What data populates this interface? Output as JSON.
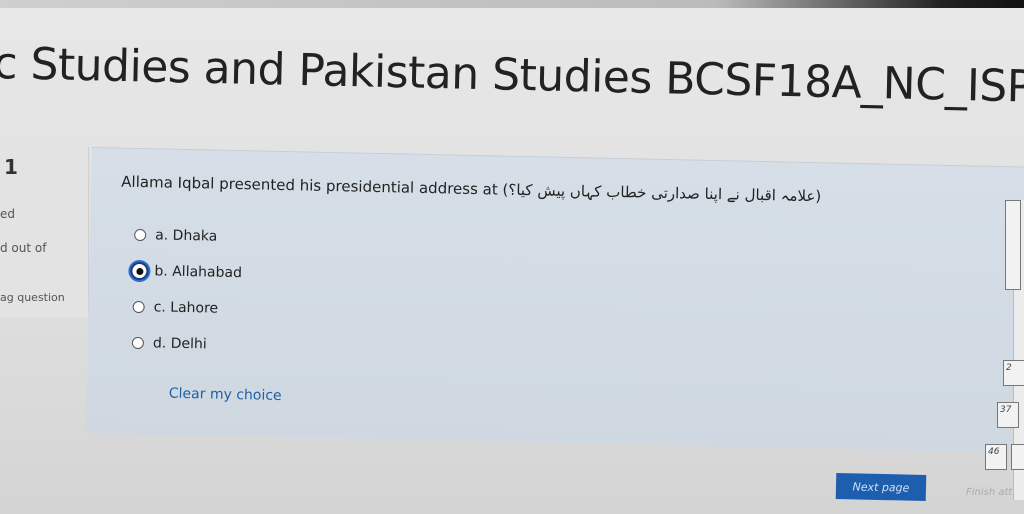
{
  "course": {
    "title": "c Studies and Pakistan Studies BCSF18A_NC_ISPS"
  },
  "question_info": {
    "number": "1",
    "status": "ed",
    "mark": "d out of",
    "flag_label": "ag question"
  },
  "question": {
    "text": "Allama Iqbal presented his presidential address at (علامہ اقبال نے اپنا صدارتی خطاب کہاں پیش کیا؟)",
    "options": [
      {
        "label": "a. Dhaka",
        "selected": false
      },
      {
        "label": "b. Allahabad",
        "selected": true
      },
      {
        "label": "c. Lahore",
        "selected": false
      },
      {
        "label": "d. Delhi",
        "selected": false
      }
    ],
    "clear_label": "Clear my choice"
  },
  "nav_panel": {
    "buttons": [
      "2",
      "37",
      "46"
    ]
  },
  "footer": {
    "next_label": "Next page",
    "finish_label": "Finish att"
  }
}
